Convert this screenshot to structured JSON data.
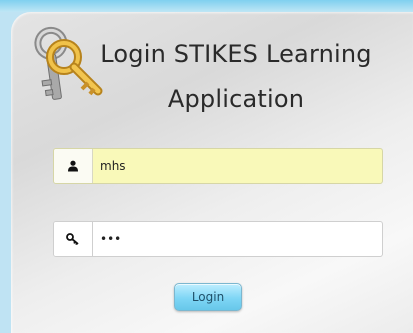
{
  "login": {
    "title": "Login STIKES Learning Application",
    "username": {
      "value": "mhs",
      "icon": "user-icon"
    },
    "password": {
      "value": "•••",
      "icon": "key-icon"
    },
    "submit_label": "Login"
  },
  "colors": {
    "username_field_bg": "#f9f9b9",
    "button_bg": "#7fd6f5",
    "frame_top": "#7fd0ef"
  }
}
